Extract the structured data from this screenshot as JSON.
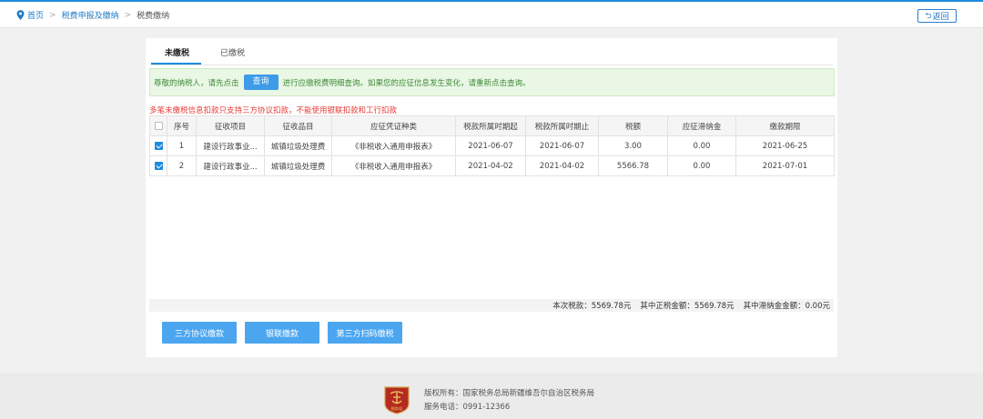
{
  "breadcrumb": {
    "home": "首页",
    "level2": "税费申报及缴纳",
    "current": "税费缴纳"
  },
  "back_button": "返回",
  "tabs": [
    {
      "label": "未缴税",
      "active": true
    },
    {
      "label": "已缴税",
      "active": false
    }
  ],
  "notice": {
    "prefix": "尊敬的纳税人，请先点击",
    "button": "查询",
    "suffix": "进行应缴税费明细查询。如果您的应征信息发生变化，请重新点击查询。"
  },
  "warning": "多笔未缴税信息扣款只支持三方协议扣款，不能使用银联扣款和工行扣款",
  "table": {
    "headers": [
      "序号",
      "征收项目",
      "征收品目",
      "应征凭证种类",
      "税款所属时期起",
      "税款所属时期止",
      "税额",
      "应征滞纳金",
      "缴款期限"
    ],
    "rows": [
      {
        "checked": true,
        "cells": [
          "1",
          "建设行政事业...",
          "城镇垃圾处理费",
          "《非税收入通用申报表》",
          "2021-06-07",
          "2021-06-07",
          "3.00",
          "0.00",
          "2021-06-25"
        ]
      },
      {
        "checked": true,
        "cells": [
          "2",
          "建设行政事业...",
          "城镇垃圾处理费",
          "《非税收入通用申报表》",
          "2021-04-02",
          "2021-04-02",
          "5566.78",
          "0.00",
          "2021-07-01"
        ]
      }
    ]
  },
  "summary": {
    "total": "本次税款：5569.78元",
    "tax": "其中正税金额：5569.78元",
    "penalty": "其中滞纳金金额：0.00元"
  },
  "actions": [
    "三方协议缴款",
    "银联缴款",
    "第三方扫码缴税"
  ],
  "footer": {
    "logo_text": "税务局",
    "copyright": "版权所有：国家税务总局新疆维吾尔自治区税务局",
    "phone": "服务电话：0991-12366"
  },
  "colors": {
    "accent": "#1f8cde",
    "button": "#4ba6ef",
    "warning": "#e53935",
    "notice_text": "#3f8a3a"
  }
}
